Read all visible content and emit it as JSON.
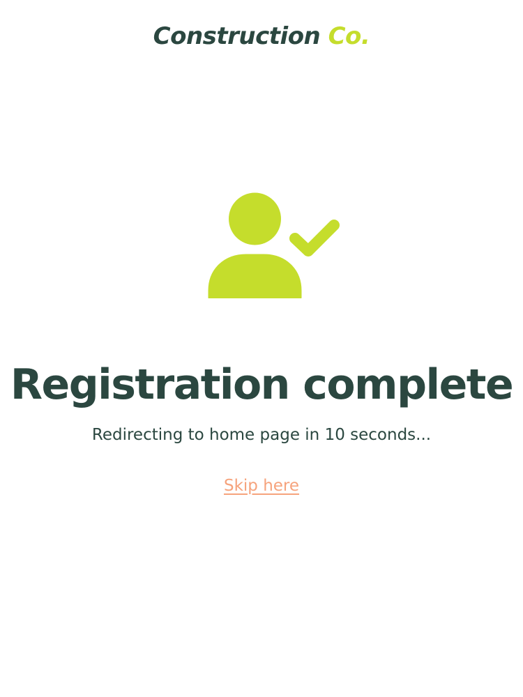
{
  "brand": {
    "name": "Construction",
    "accent": "Co."
  },
  "icon": {
    "name": "user-check-icon",
    "color": "#c5dd2c"
  },
  "headline": "Registration complete",
  "redirect": {
    "prefix": "Redirecting to home page in ",
    "seconds": "10",
    "suffix": " seconds..."
  },
  "skip_link": {
    "label": "Skip here"
  },
  "colors": {
    "primary_text": "#2b4740",
    "accent": "#c5dd2c",
    "link": "#f6a37c",
    "background": "#ffffff"
  }
}
